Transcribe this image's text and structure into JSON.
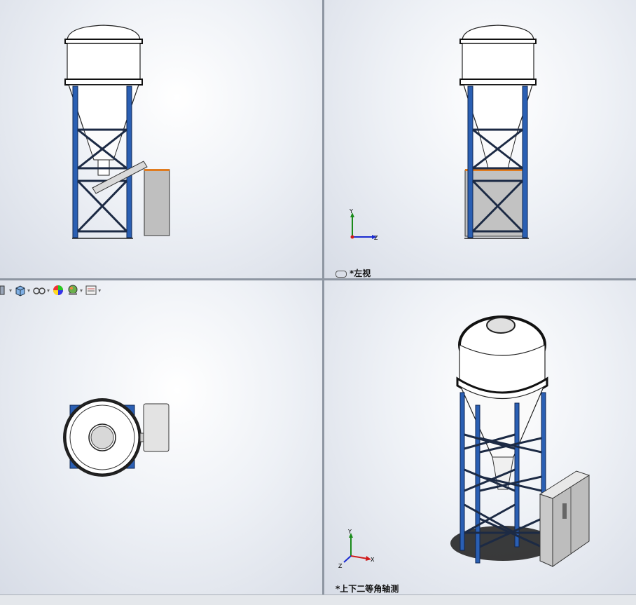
{
  "viewports": {
    "front": {
      "label": ""
    },
    "left": {
      "label": "*左视",
      "label_icon": "link-icon"
    },
    "top": {
      "label": ""
    },
    "iso": {
      "label": "*上下二等角轴测"
    }
  },
  "triad": {
    "x": "X",
    "y": "Y",
    "z": "Z"
  },
  "toolbar": {
    "items": [
      "display-style-icon",
      "view-orientation-icon",
      "hide-show-icon",
      "edit-appearance-icon",
      "apply-scene-icon",
      "view-settings-icon"
    ]
  },
  "colors": {
    "steel_frame": "#2a5fb3",
    "bracing": "#1c2a44",
    "tank": "#ffffff",
    "cabinet": "#bfbfbf",
    "cabinet_top": "#e07b1f",
    "triad_x": "#d01a1a",
    "triad_y": "#1a8a1a",
    "triad_z": "#1a2ad0"
  }
}
